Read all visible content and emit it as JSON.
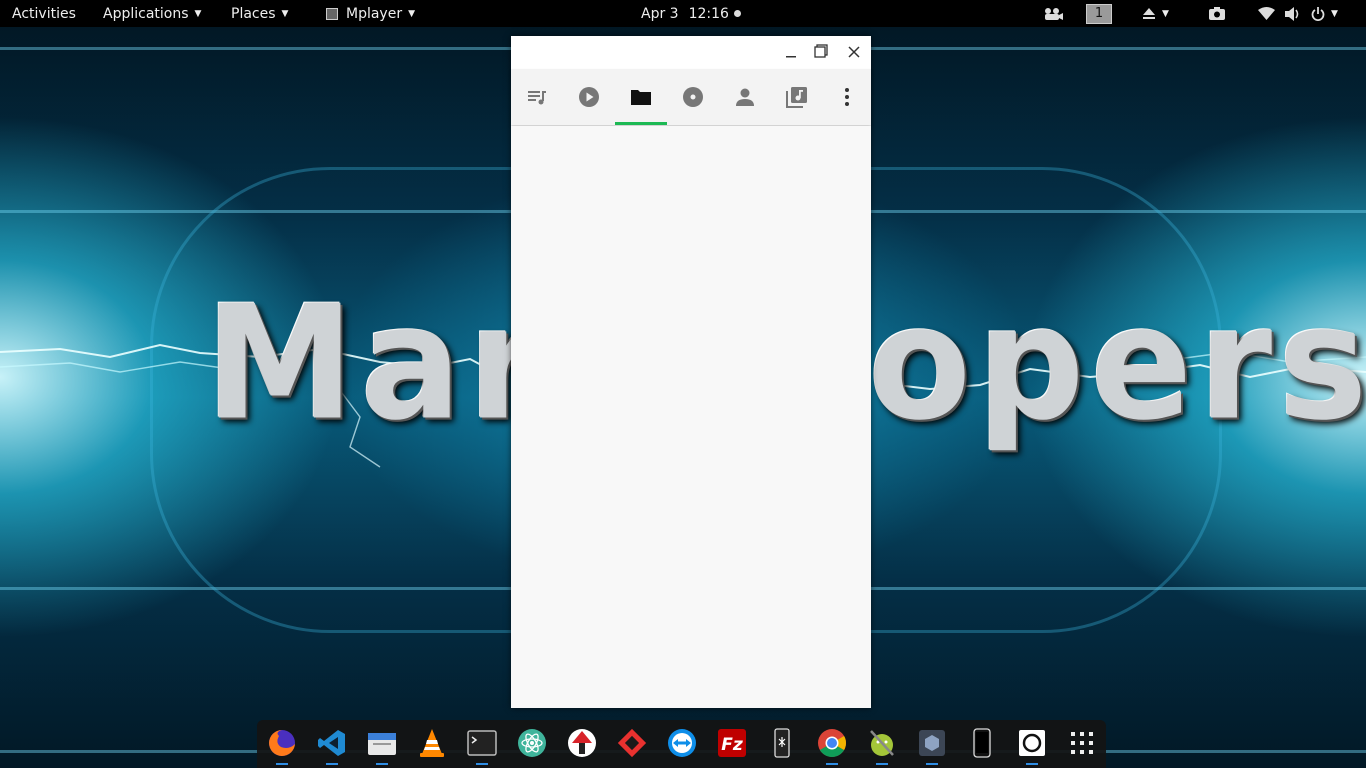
{
  "topbar": {
    "activities": "Activities",
    "applications": "Applications",
    "places": "Places",
    "app_menu": "Mplayer",
    "date": "Apr 3",
    "time": "12:16",
    "workspace": "1"
  },
  "wallpaper": {
    "text_left": "Mart",
    "text_right": "opers"
  },
  "window": {
    "tabs": [
      {
        "icon": "playlist-icon",
        "active": false
      },
      {
        "icon": "play-circle-icon",
        "active": false
      },
      {
        "icon": "folder-icon",
        "active": true
      },
      {
        "icon": "album-disc-icon",
        "active": false
      },
      {
        "icon": "artist-person-icon",
        "active": false
      },
      {
        "icon": "music-library-icon",
        "active": false
      },
      {
        "icon": "more-vert-icon",
        "active": false
      }
    ],
    "accent": "#1db954"
  },
  "dock": {
    "apps": [
      "firefox",
      "vscode",
      "files",
      "vlc",
      "terminal",
      "atom",
      "unknown-red-white",
      "anydesk",
      "teamviewer",
      "filezilla",
      "kde-connect",
      "chrome",
      "android-studio",
      "virtualbox",
      "phone",
      "screenshot",
      "show-applications"
    ]
  }
}
